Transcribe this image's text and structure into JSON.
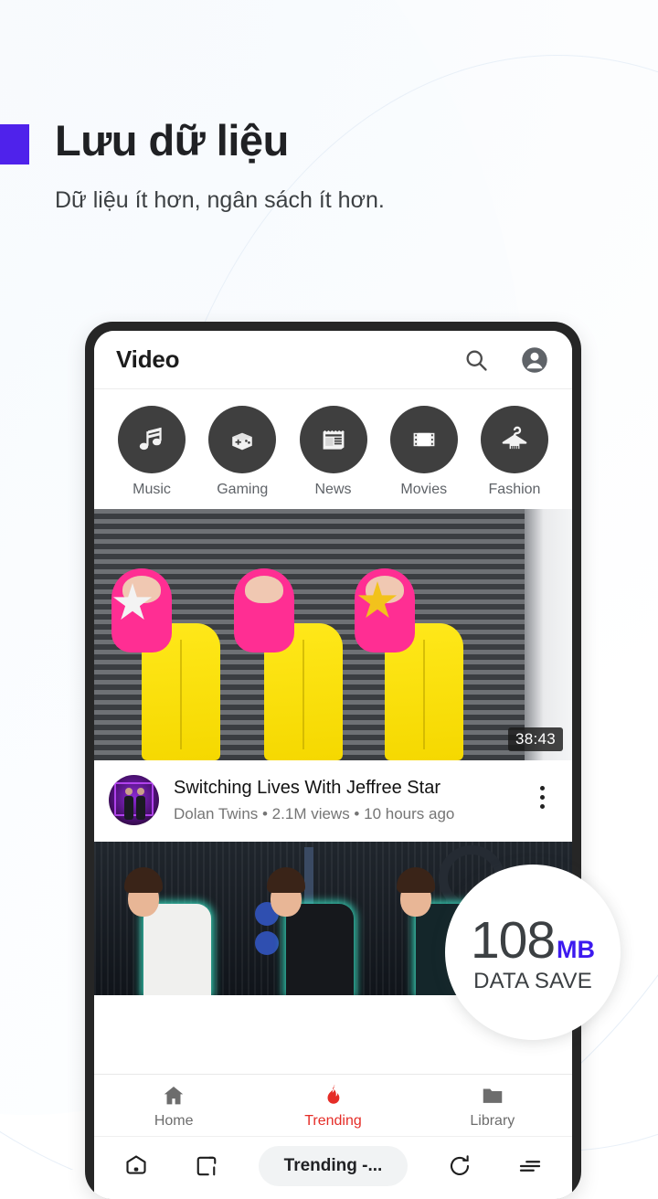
{
  "promo": {
    "headline": "Lưu dữ liệu",
    "subheadline": "Dữ liệu ít hơn, ngân sách ít hơn.",
    "accent_color": "#4F22EB"
  },
  "app": {
    "title": "Video",
    "actions": [
      {
        "name": "search-icon",
        "label": "Search"
      },
      {
        "name": "account-icon",
        "label": "Account"
      }
    ],
    "categories": [
      {
        "label": "Music",
        "icon": "music-note-icon"
      },
      {
        "label": "Gaming",
        "icon": "gamepad-icon"
      },
      {
        "label": "News",
        "icon": "newspaper-icon"
      },
      {
        "label": "Movies",
        "icon": "film-strip-icon"
      },
      {
        "label": "Fashion",
        "icon": "clothes-hanger-icon"
      }
    ],
    "feed": [
      {
        "duration": "38:43",
        "title": "Switching Lives With Jeffree Star",
        "channel": "Dolan Twins",
        "views": "2.1M views",
        "age": "10 hours ago",
        "meta_line": "Dolan Twins • 2.1M views • 10 hours ago"
      },
      {
        "duration": "",
        "title": "",
        "meta_line": ""
      }
    ],
    "bottom_nav": [
      {
        "label": "Home",
        "icon": "home-icon",
        "active": false
      },
      {
        "label": "Trending",
        "icon": "flame-icon",
        "active": true,
        "color": "#e52d27"
      },
      {
        "label": "Library",
        "icon": "folder-icon",
        "active": false
      }
    ]
  },
  "browser": {
    "home_icon": "home-outline-icon",
    "tabs_icon": "tab-switcher-icon",
    "url_text": "Trending -...",
    "reload_icon": "reload-icon",
    "menu_icon": "menu-icon"
  },
  "data_badge": {
    "value": "108",
    "unit": "MB",
    "caption": "DATA SAVE",
    "unit_color": "#3d1aef"
  }
}
